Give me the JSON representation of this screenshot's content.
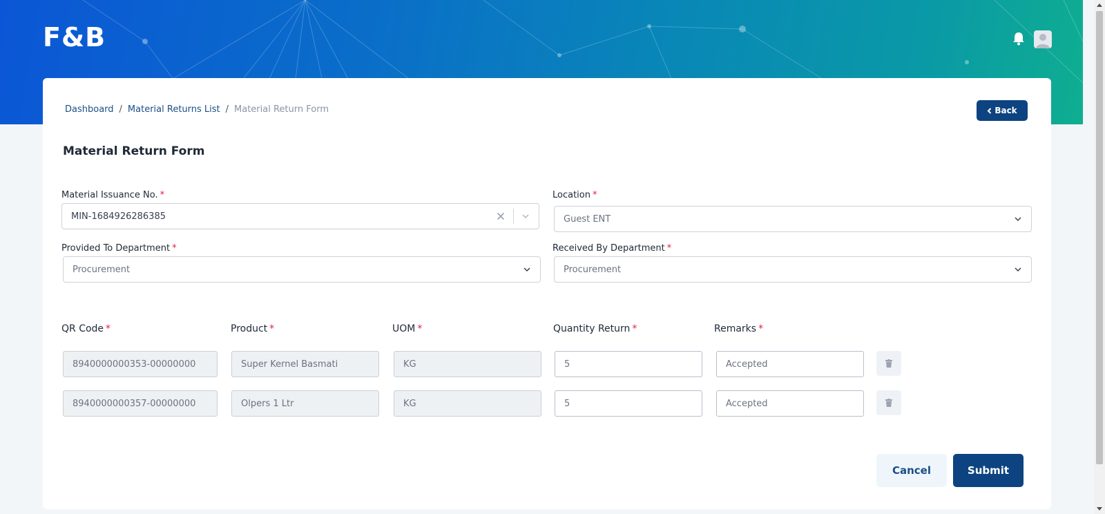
{
  "app": {
    "logo": "F&B"
  },
  "breadcrumb": {
    "items": [
      "Dashboard",
      "Material Returns List"
    ],
    "separator": "/",
    "current": "Material Return Form"
  },
  "back_button": {
    "label": "Back"
  },
  "page_title": "Material Return Form",
  "form": {
    "material_issuance": {
      "label": "Material Issuance No.",
      "value": "MIN-1684926286385"
    },
    "location": {
      "label": "Location",
      "value": "Guest ENT"
    },
    "provided_to": {
      "label": "Provided To Department",
      "value": "Procurement"
    },
    "received_by": {
      "label": "Received By Department",
      "value": "Procurement"
    },
    "required_mark": "*"
  },
  "items_table": {
    "columns": [
      "QR Code",
      "Product",
      "UOM",
      "Quantity Return",
      "Remarks"
    ],
    "rows": [
      {
        "qr_code": "8940000000353-00000000",
        "product": "Super Kernel Basmati",
        "uom": "KG",
        "quantity": "5",
        "remarks": "Accepted"
      },
      {
        "qr_code": "8940000000357-00000000",
        "product": "Olpers 1 Ltr",
        "uom": "KG",
        "quantity": "5",
        "remarks": "Accepted"
      }
    ]
  },
  "actions": {
    "cancel": "Cancel",
    "submit": "Submit"
  },
  "colors": {
    "primary": "#0d4380",
    "link": "#1a4f86",
    "required": "#e11d48",
    "header_gradient_start": "#0b56d6",
    "header_gradient_end": "#0fae90"
  },
  "icons": [
    "bell-icon",
    "avatar-icon",
    "chevron-left-icon",
    "chevron-down-icon",
    "clear-icon",
    "trash-icon"
  ]
}
